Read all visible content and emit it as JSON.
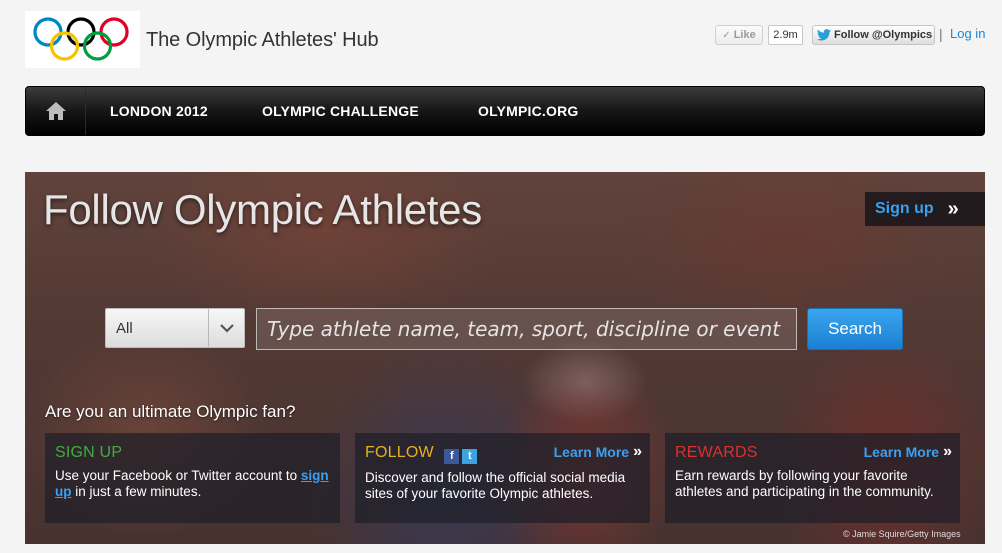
{
  "header": {
    "site_title": "The Olympic Athletes' Hub",
    "like_label": "Like",
    "like_count": "2.9m",
    "follow_label": "Follow @Olympics",
    "separator": "|",
    "login_label": "Log in"
  },
  "nav": {
    "items": [
      {
        "label": "LONDON 2012"
      },
      {
        "label": "OLYMPIC CHALLENGE"
      },
      {
        "label": "OLYMPIC.ORG"
      }
    ]
  },
  "hero": {
    "title": "Follow Olympic Athletes",
    "signup_label": "Sign up",
    "chevron": "»",
    "search": {
      "select_value": "All",
      "placeholder": "Type athlete name, team, sport, discipline or event",
      "button_label": "Search"
    },
    "question": "Are you an ultimate Olympic fan?",
    "cards": [
      {
        "title": "SIGN UP",
        "title_color": "#3fae3f",
        "body_before": "Use your Facebook or Twitter account to",
        "body_link": "sign up",
        "body_after": "in just a few minutes."
      },
      {
        "title": "FOLLOW",
        "title_color": "#e8b020",
        "learn_more": "Learn More",
        "fb_glyph": "f",
        "tw_glyph": "t",
        "body": "Discover and follow the official social media sites of your favorite Olympic athletes."
      },
      {
        "title": "REWARDS",
        "title_color": "#d8322f",
        "learn_more": "Learn More",
        "body": "Earn rewards by following your favorite athletes and participating in the community."
      }
    ],
    "credit": "© Jamie Squire/Getty Images"
  },
  "colors": {
    "accent_blue": "#1a86d9",
    "nav_bg": "#111111",
    "olympic_rings": [
      "#0085c7",
      "#000000",
      "#df0024",
      "#f4c300",
      "#009f3d"
    ]
  }
}
